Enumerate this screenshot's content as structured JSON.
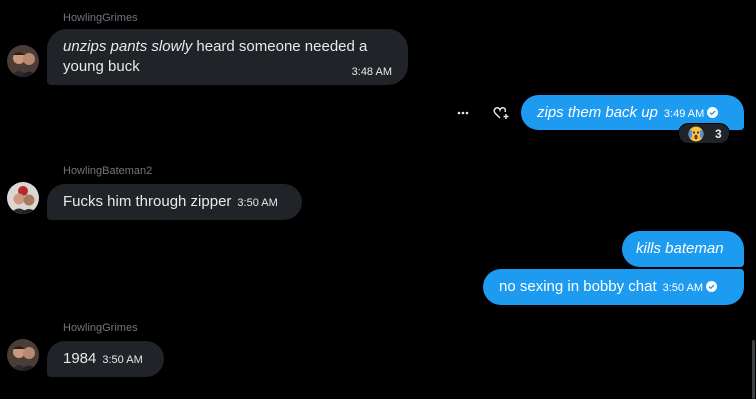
{
  "theme": {
    "background": "#000000",
    "incoming_bubble": "#202327",
    "outgoing_bubble": "#1d9bf0",
    "muted_text": "#71767b"
  },
  "messages": [
    {
      "sender": "HowlingGrimes",
      "direction": "incoming",
      "italic_part": "unzips pants slowly",
      "text_part": " heard someone needed a young buck",
      "time": "3:48 AM"
    },
    {
      "direction": "outgoing",
      "text": "zips them back up",
      "time": "3:49 AM",
      "reaction": {
        "icon": "screaming-face-icon",
        "count": "3"
      },
      "actions": [
        "more-options-icon",
        "add-reaction-icon"
      ]
    },
    {
      "sender": "HowlingBateman2",
      "direction": "incoming",
      "text": "Fucks him through zipper",
      "time": "3:50 AM"
    },
    {
      "direction": "outgoing",
      "text": "kills bateman"
    },
    {
      "direction": "outgoing",
      "text": "no sexing in bobby chat",
      "time": "3:50 AM"
    },
    {
      "sender": "HowlingGrimes",
      "direction": "incoming",
      "text": "1984",
      "time": "3:50 AM"
    }
  ]
}
